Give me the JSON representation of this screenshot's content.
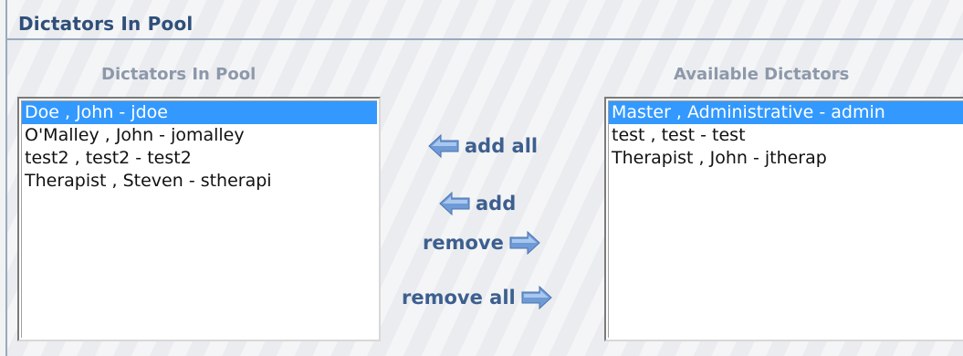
{
  "panel": {
    "title": "Dictators In Pool"
  },
  "left": {
    "header": "Dictators In Pool",
    "items": [
      {
        "label": "Doe , John - jdoe",
        "selected": true
      },
      {
        "label": "O'Malley , John - jomalley",
        "selected": false
      },
      {
        "label": "test2 , test2 - test2",
        "selected": false
      },
      {
        "label": "Therapist , Steven - stherapi",
        "selected": false
      }
    ]
  },
  "right": {
    "header": "Available Dictators",
    "items": [
      {
        "label": "Master , Administrative - admin",
        "selected": true
      },
      {
        "label": "test , test - test",
        "selected": false
      },
      {
        "label": "Therapist , John - jtherap",
        "selected": false
      }
    ]
  },
  "actions": {
    "add_all": "add all",
    "add": "add",
    "remove": "remove",
    "remove_all": "remove all"
  },
  "icons": {
    "left_arrow": "arrow-left-icon",
    "right_arrow": "arrow-right-icon"
  },
  "colors": {
    "title": "#2f4f7a",
    "header": "#8d98aa",
    "selection": "#3399ff",
    "button_text": "#3d5f8f",
    "arrow": "#6e9ad6"
  }
}
